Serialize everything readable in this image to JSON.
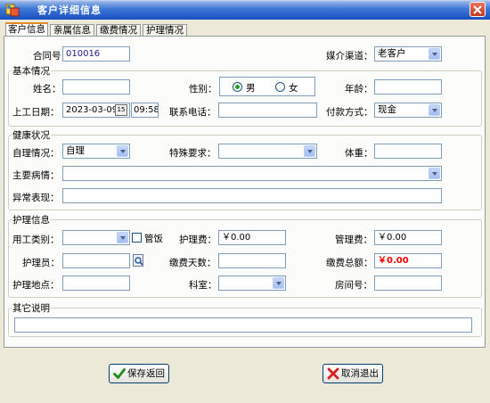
{
  "window": {
    "title": "客户详细信息"
  },
  "tabs": [
    "客户信息",
    "亲属信息",
    "缴费情况",
    "护理情况"
  ],
  "contract": {
    "no_label": "合同号：",
    "no_value": "010016",
    "channel_label": "媒介渠道：",
    "channel_value": "老客户"
  },
  "basic": {
    "group_label": "基本情况",
    "name_label": "姓名：",
    "name_value": "",
    "gender_label": "性别：",
    "male": "男",
    "female": "女",
    "age_label": "年龄：",
    "age_value": "",
    "start_label": "上工日期：",
    "start_date": "2023-03-09",
    "calendar_glyph": "15",
    "start_time": "09:58",
    "phone_label": "联系电话：",
    "phone_value": "",
    "pay_label": "付款方式：",
    "pay_value": "现金"
  },
  "health": {
    "group_label": "健康状况",
    "self_label": "自理情况：",
    "self_value": "自理",
    "special_label": "特殊要求：",
    "special_value": "",
    "weight_label": "体重：",
    "weight_value": "",
    "disease_label": "主要病情：",
    "disease_value": "",
    "abnormal_label": "异常表现：",
    "abnormal_value": ""
  },
  "nursing": {
    "group_label": "护理信息",
    "type_label": "用工类别：",
    "type_value": "",
    "meal_label": "管饭",
    "fee_label": "护理费：",
    "fee_value": "￥0.00",
    "mgmt_label": "管理费：",
    "mgmt_value": "￥0.00",
    "nurse_label": "护理员：",
    "nurse_value": "",
    "days_label": "缴费天数：",
    "days_value": "",
    "total_label": "缴费总额：",
    "total_value": "￥0.00",
    "place_label": "护理地点：",
    "place_value": "",
    "dept_label": "科室：",
    "dept_value": "",
    "room_label": "房间号：",
    "room_value": ""
  },
  "other": {
    "group_label": "其它说明",
    "value": ""
  },
  "buttons": {
    "save": "保存返回",
    "cancel": "取消退出"
  },
  "colors": {
    "total_value": "#ff0000",
    "tab_accent": "#e68b2c"
  },
  "icons": [
    "app-icon",
    "close-icon",
    "calendar-icon",
    "search-icon",
    "check-icon",
    "cross-icon"
  ]
}
